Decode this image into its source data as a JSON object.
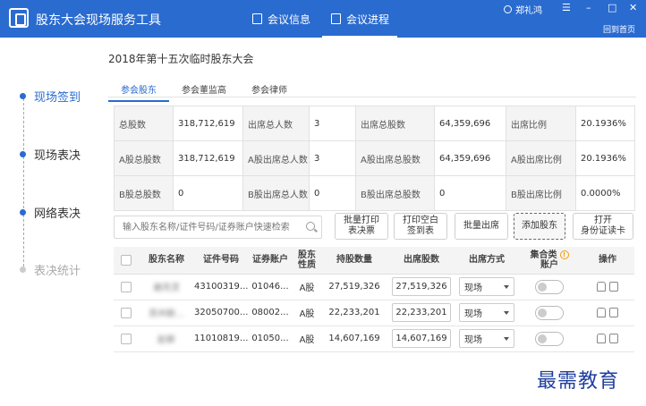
{
  "app": {
    "title": "股东大会现场服务工具"
  },
  "topnav": {
    "item1": "会议信息",
    "item2": "会议进程"
  },
  "user": {
    "name": "郑礼鸿"
  },
  "window": {
    "menu": "☰",
    "minimize": "–",
    "maximize": "□",
    "close": "✕",
    "home": "回到首页"
  },
  "sidebar": {
    "steps": [
      {
        "label": "现场签到"
      },
      {
        "label": "现场表决"
      },
      {
        "label": "网络表决"
      },
      {
        "label": "表决统计"
      }
    ]
  },
  "meeting": {
    "title": "2018年第十五次临时股东大会"
  },
  "tabs": [
    "参会股东",
    "参会董监高",
    "参会律师"
  ],
  "stats": {
    "rows": [
      [
        {
          "label": "总股数",
          "value": "318,712,619"
        },
        {
          "label": "出席总人数",
          "value": "3"
        },
        {
          "label": "出席总股数",
          "value": "64,359,696"
        },
        {
          "label": "出席比例",
          "value": "20.1936%"
        }
      ],
      [
        {
          "label": "A股总股数",
          "value": "318,712,619"
        },
        {
          "label": "A股出席总人数",
          "value": "3"
        },
        {
          "label": "A股出席总股数",
          "value": "64,359,696"
        },
        {
          "label": "A股出席比例",
          "value": "20.1936%"
        }
      ],
      [
        {
          "label": "B股总股数",
          "value": "0"
        },
        {
          "label": "B股出席总人数",
          "value": "0"
        },
        {
          "label": "B股出席总股数",
          "value": "0"
        },
        {
          "label": "B股出席比例",
          "value": "0.0000%"
        }
      ]
    ]
  },
  "search": {
    "placeholder": "输入股东名称/证件号码/证券账户快速检索"
  },
  "buttons": {
    "batch_print": [
      "批量打印",
      "表决票"
    ],
    "print_blank": [
      "打印空白",
      "签到表"
    ],
    "batch_attend": "批量出席",
    "add_shareholder": "添加股东",
    "open_reader": [
      "打开",
      "身份证读卡"
    ]
  },
  "table": {
    "headers": {
      "name": "股东名称",
      "id_no": "证件号码",
      "account": "证券账户",
      "nature": [
        "股东",
        "性质"
      ],
      "shares": "持股数量",
      "attend_shares": "出席股数",
      "method": "出席方式",
      "collective": [
        "集合类",
        "账户"
      ],
      "ops": "操作"
    },
    "rows": [
      {
        "name": "谢月灵",
        "id_no": "43100319...",
        "account": "01046...",
        "nature": "A股",
        "shares": "27,519,326",
        "attend": "27,519,326",
        "method": "现场"
      },
      {
        "name": "苏州新...",
        "id_no": "32050700...",
        "account": "08002...",
        "nature": "A股",
        "shares": "22,233,201",
        "attend": "22,233,201",
        "method": "现场"
      },
      {
        "name": "赵新",
        "id_no": "11010819...",
        "account": "01050...",
        "nature": "A股",
        "shares": "14,607,169",
        "attend": "14,607,169",
        "method": "现场"
      }
    ]
  },
  "watermark": "最需教育"
}
